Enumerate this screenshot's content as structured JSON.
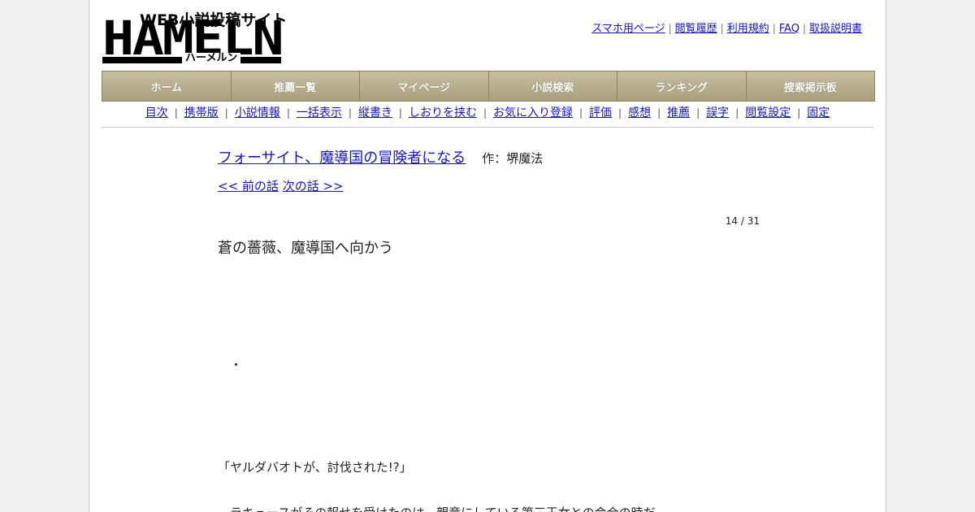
{
  "logo": {
    "tagline": "WEB小説投稿サイト",
    "wordmark": "HAMELN",
    "kana": "ハーメルン"
  },
  "header_links": [
    "スマホ用ページ",
    "閲覧履歴",
    "利用規約",
    "FAQ",
    "取扱説明書"
  ],
  "main_nav": [
    "ホーム",
    "推薦一覧",
    "マイページ",
    "小説検索",
    "ランキング",
    "捜索掲示板"
  ],
  "sub_nav": [
    "目次",
    "携帯版",
    "小説情報",
    "一括表示",
    "縦書き",
    "しおりを挟む",
    "お気に入り登録",
    "評価",
    "感想",
    "推薦",
    "誤字",
    "閲覧設定",
    "固定"
  ],
  "separator": "|",
  "novel": {
    "title": "フォーサイト、魔導国の冒険者になる",
    "author": "作：堺魔法",
    "prev": "<< 前の話",
    "next": "次の話 >>",
    "page_count": "14 / 31",
    "chapter_title": "蒼の薔薇、魔導国へ向かう",
    "lines": [
      "　・",
      "「ヤルダバオトが、討伐された!?」",
      "　ラキュースがその報せを受けたのは、親竜にしている第三王女との会合の時だ"
    ]
  }
}
